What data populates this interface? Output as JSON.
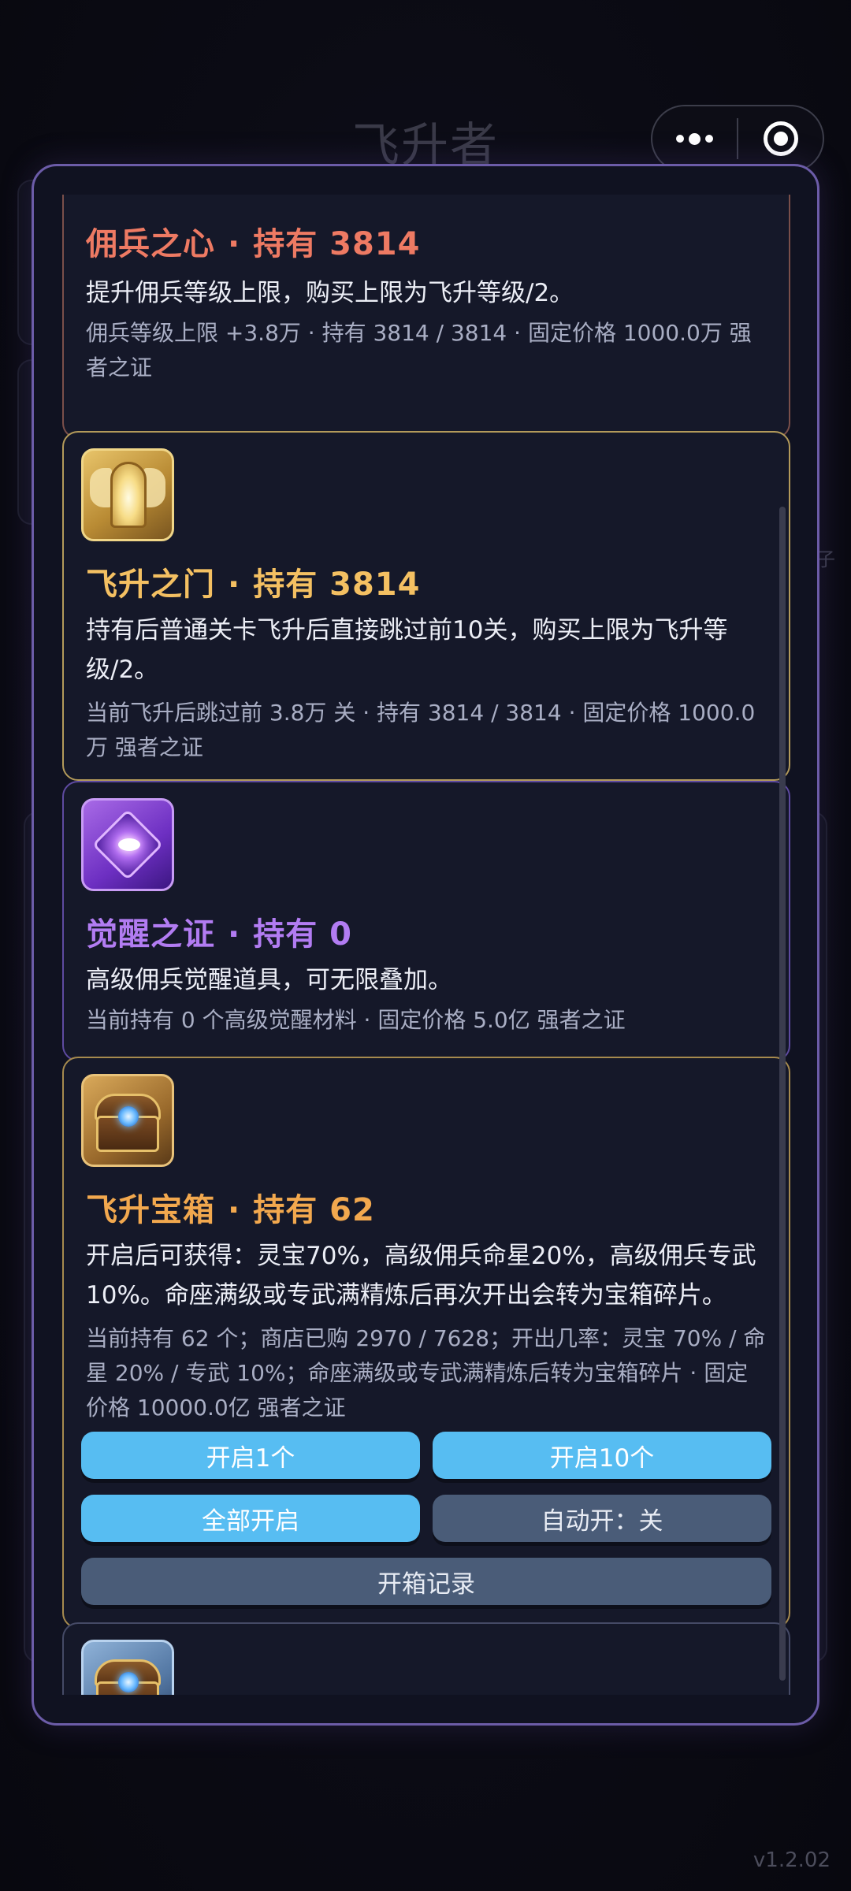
{
  "page": {
    "title": "飞升者",
    "version": "v1.2.02",
    "side_text": "子"
  },
  "capsule": {
    "more_icon": "more-dots-icon",
    "close_icon": "target-close-icon"
  },
  "items": {
    "mercenary_heart": {
      "name": "佣兵之心",
      "held_label": "持有 3814",
      "description": "提升佣兵等级上限，购买上限为飞升等级/2。",
      "meta": "佣兵等级上限 +3.8万 · 持有 3814 / 3814 · 固定价格 1000.0万 强者之证"
    },
    "ascension_gate": {
      "icon": "golden-gate-icon",
      "name": "飞升之门",
      "held_label": "持有 3814",
      "description": "持有后普通关卡飞升后直接跳过前10关，购买上限为飞升等级/2。",
      "meta": "当前飞升后跳过前 3.8万 关 · 持有 3814 / 3814 · 固定价格 1000.0万 强者之证"
    },
    "awakening_proof": {
      "icon": "purple-crystal-icon",
      "name": "觉醒之证",
      "held_label": "持有 0",
      "description": "高级佣兵觉醒道具，可无限叠加。",
      "meta": "当前持有 0 个高级觉醒材料 · 固定价格 5.0亿 强者之证"
    },
    "ascension_chest": {
      "icon": "treasure-chest-icon",
      "name": "飞升宝箱",
      "held_label": "持有 62",
      "description": "开启后可获得：灵宝70%，高级佣兵命星20%，高级佣兵专武10%。命座满级或专武满精炼后再次开出会转为宝箱碎片。",
      "meta": "当前持有 62 个；商店已购 2970 / 7628；开出几率：灵宝 70% / 命星 20% / 专武 10%；命座满级或专武满精炼后转为宝箱碎片 · 固定价格 10000.0亿 强者之证",
      "buttons": {
        "open_one": "开启1个",
        "open_ten": "开启10个",
        "open_all": "全部开启",
        "auto_open": "自动开：关",
        "history": "开箱记录"
      }
    },
    "next_chest": {
      "icon": "blue-chest-icon"
    }
  },
  "separator": "·"
}
